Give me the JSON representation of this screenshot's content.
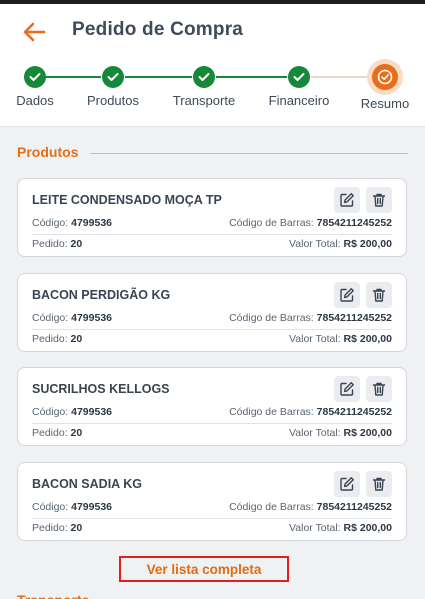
{
  "header": {
    "title": "Pedido de Compra"
  },
  "stepper": {
    "steps": [
      {
        "label": "Dados",
        "state": "done"
      },
      {
        "label": "Produtos",
        "state": "done"
      },
      {
        "label": "Transporte",
        "state": "done"
      },
      {
        "label": "Financeiro",
        "state": "done"
      },
      {
        "label": "Resumo",
        "state": "active"
      }
    ]
  },
  "section": {
    "title": "Produtos",
    "next_title": "Transporte"
  },
  "labels": {
    "code": "Código:",
    "barcode": "Código de Barras:",
    "order": "Pedido:",
    "total": "Valor Total:"
  },
  "products": [
    {
      "name": "LEITE CONDENSADO MOÇA TP",
      "code": "4799536",
      "barcode": "7854211245252",
      "order": "20",
      "total": "R$ 200,00"
    },
    {
      "name": "BACON PERDIGÃO KG",
      "code": "4799536",
      "barcode": "7854211245252",
      "order": "20",
      "total": "R$ 200,00"
    },
    {
      "name": "SUCRILHOS KELLOGS",
      "code": "4799536",
      "barcode": "7854211245252",
      "order": "20",
      "total": "R$ 200,00"
    },
    {
      "name": "BACON SADIA KG",
      "code": "4799536",
      "barcode": "7854211245252",
      "order": "20",
      "total": "R$ 200,00"
    }
  ],
  "see_all": "Ver lista completa",
  "colors": {
    "accent": "#ea6d1c",
    "done": "#15883a",
    "highlight": "#e0201e"
  },
  "icons": {
    "back": "arrow-left-icon",
    "edit": "edit-icon",
    "delete": "trash-icon",
    "check": "check-icon"
  }
}
